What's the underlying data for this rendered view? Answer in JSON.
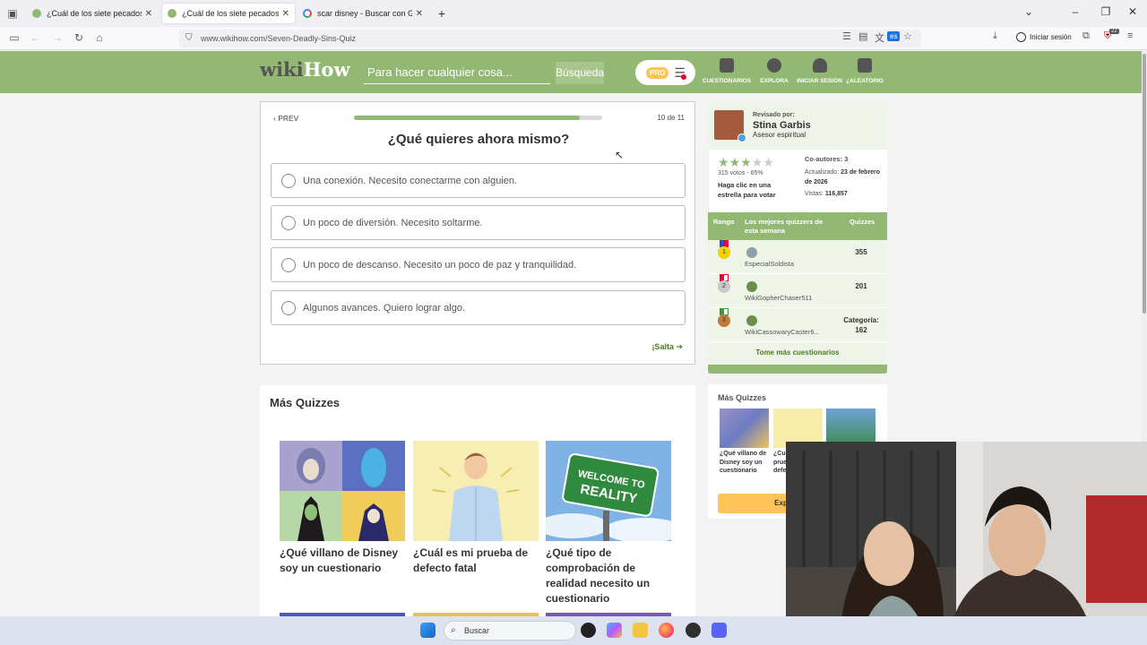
{
  "browser": {
    "tabs": [
      {
        "title": "¿Cuál de los siete pecados capi",
        "close": "✕"
      },
      {
        "title": "¿Cuál de los siete pecados capi",
        "close": "✕"
      },
      {
        "title": "scar disney - Buscar con Google",
        "close": "✕"
      }
    ],
    "new_tab": "+",
    "url": "www.wikihow.com/Seven-Deadly-Sins-Quiz",
    "sign_in": "Iniciar sesión",
    "translate_badge": "es",
    "extension_count": "22"
  },
  "header": {
    "logo_wiki": "wiki",
    "logo_how": "How",
    "search_placeholder": "Para hacer cualquier cosa...",
    "search_button": "Búsqueda",
    "pro": "PRO",
    "nav": [
      "CUESTIONARIOS",
      "EXPLORA",
      "INICIAR SESIÓN",
      "¿ALEATORIO"
    ]
  },
  "quiz": {
    "prev": "PREV",
    "progress_text": "10 de 11",
    "progress_fraction": 0.91,
    "question": "¿Qué quieres ahora mismo?",
    "answers": [
      "Una conexión. Necesito conectarme con alguien.",
      "Un poco de diversión. Necesito soltarme.",
      "Un poco de descanso. Necesito un poco de paz y tranquilidad.",
      "Algunos avances. Quiero lograr algo."
    ],
    "skip": "¡Salta ➔"
  },
  "sidebar": {
    "reviewed_by": "Revisado por:",
    "reviewer_name": "Stina Garbis",
    "reviewer_role": "Asesor espiritual",
    "rating_stars": 3,
    "votes": "315 votos - 65%",
    "vote_hint": "Haga clic en una estrella para votar",
    "coauthors": "Co-autores: 3",
    "updated_label": "Actualizado:",
    "updated_value": "23 de febrero de 2026",
    "views_label": "Vistas:",
    "views_value": "116,857",
    "leaderboard": {
      "col_rank": "Rango",
      "col_name": "Los mejores quizzers de esta semana",
      "col_score": "Quizzes",
      "rows": [
        {
          "rank": "1",
          "name": "EspecialSoldista",
          "score": "355"
        },
        {
          "rank": "2",
          "name": "WikiGopherChaser511",
          "score": "201"
        },
        {
          "rank": "3",
          "name": "WikiCassowaryCaster6...",
          "score": "Categoría: 162"
        }
      ],
      "more": "Tome más cuestionarios"
    },
    "more_title": "Más Quizzes",
    "more_items": [
      "¿Qué villano de Disney soy un cuestionario",
      "¿Cu prue defe"
    ],
    "explore": "Explorar Todo"
  },
  "more_quizzes": {
    "title": "Más Quizzes",
    "items": [
      "¿Qué villano de Disney soy un cuestionario",
      "¿Cuál es mi prueba de defecto fatal",
      "¿Qué tipo de comprobación de realidad necesito un cuestionario"
    ],
    "sign_text": "WELCOME TO REALITY"
  },
  "taskbar": {
    "search": "Buscar"
  },
  "colors": {
    "brand_green": "#93b874",
    "dark_green": "#4a7c1f",
    "pro_yellow": "#ffc357"
  }
}
